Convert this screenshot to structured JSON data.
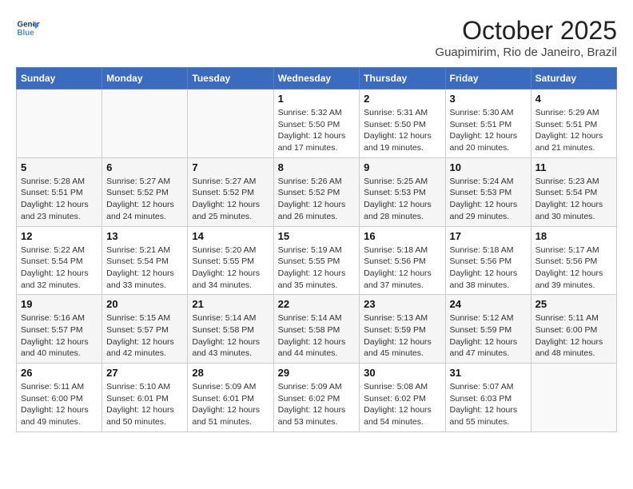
{
  "header": {
    "logo_line1": "General",
    "logo_line2": "Blue",
    "month": "October 2025",
    "location": "Guapimirim, Rio de Janeiro, Brazil"
  },
  "weekdays": [
    "Sunday",
    "Monday",
    "Tuesday",
    "Wednesday",
    "Thursday",
    "Friday",
    "Saturday"
  ],
  "weeks": [
    [
      {
        "day": "",
        "info": ""
      },
      {
        "day": "",
        "info": ""
      },
      {
        "day": "",
        "info": ""
      },
      {
        "day": "1",
        "info": "Sunrise: 5:32 AM\nSunset: 5:50 PM\nDaylight: 12 hours\nand 17 minutes."
      },
      {
        "day": "2",
        "info": "Sunrise: 5:31 AM\nSunset: 5:50 PM\nDaylight: 12 hours\nand 19 minutes."
      },
      {
        "day": "3",
        "info": "Sunrise: 5:30 AM\nSunset: 5:51 PM\nDaylight: 12 hours\nand 20 minutes."
      },
      {
        "day": "4",
        "info": "Sunrise: 5:29 AM\nSunset: 5:51 PM\nDaylight: 12 hours\nand 21 minutes."
      }
    ],
    [
      {
        "day": "5",
        "info": "Sunrise: 5:28 AM\nSunset: 5:51 PM\nDaylight: 12 hours\nand 23 minutes."
      },
      {
        "day": "6",
        "info": "Sunrise: 5:27 AM\nSunset: 5:52 PM\nDaylight: 12 hours\nand 24 minutes."
      },
      {
        "day": "7",
        "info": "Sunrise: 5:27 AM\nSunset: 5:52 PM\nDaylight: 12 hours\nand 25 minutes."
      },
      {
        "day": "8",
        "info": "Sunrise: 5:26 AM\nSunset: 5:52 PM\nDaylight: 12 hours\nand 26 minutes."
      },
      {
        "day": "9",
        "info": "Sunrise: 5:25 AM\nSunset: 5:53 PM\nDaylight: 12 hours\nand 28 minutes."
      },
      {
        "day": "10",
        "info": "Sunrise: 5:24 AM\nSunset: 5:53 PM\nDaylight: 12 hours\nand 29 minutes."
      },
      {
        "day": "11",
        "info": "Sunrise: 5:23 AM\nSunset: 5:54 PM\nDaylight: 12 hours\nand 30 minutes."
      }
    ],
    [
      {
        "day": "12",
        "info": "Sunrise: 5:22 AM\nSunset: 5:54 PM\nDaylight: 12 hours\nand 32 minutes."
      },
      {
        "day": "13",
        "info": "Sunrise: 5:21 AM\nSunset: 5:54 PM\nDaylight: 12 hours\nand 33 minutes."
      },
      {
        "day": "14",
        "info": "Sunrise: 5:20 AM\nSunset: 5:55 PM\nDaylight: 12 hours\nand 34 minutes."
      },
      {
        "day": "15",
        "info": "Sunrise: 5:19 AM\nSunset: 5:55 PM\nDaylight: 12 hours\nand 35 minutes."
      },
      {
        "day": "16",
        "info": "Sunrise: 5:18 AM\nSunset: 5:56 PM\nDaylight: 12 hours\nand 37 minutes."
      },
      {
        "day": "17",
        "info": "Sunrise: 5:18 AM\nSunset: 5:56 PM\nDaylight: 12 hours\nand 38 minutes."
      },
      {
        "day": "18",
        "info": "Sunrise: 5:17 AM\nSunset: 5:56 PM\nDaylight: 12 hours\nand 39 minutes."
      }
    ],
    [
      {
        "day": "19",
        "info": "Sunrise: 5:16 AM\nSunset: 5:57 PM\nDaylight: 12 hours\nand 40 minutes."
      },
      {
        "day": "20",
        "info": "Sunrise: 5:15 AM\nSunset: 5:57 PM\nDaylight: 12 hours\nand 42 minutes."
      },
      {
        "day": "21",
        "info": "Sunrise: 5:14 AM\nSunset: 5:58 PM\nDaylight: 12 hours\nand 43 minutes."
      },
      {
        "day": "22",
        "info": "Sunrise: 5:14 AM\nSunset: 5:58 PM\nDaylight: 12 hours\nand 44 minutes."
      },
      {
        "day": "23",
        "info": "Sunrise: 5:13 AM\nSunset: 5:59 PM\nDaylight: 12 hours\nand 45 minutes."
      },
      {
        "day": "24",
        "info": "Sunrise: 5:12 AM\nSunset: 5:59 PM\nDaylight: 12 hours\nand 47 minutes."
      },
      {
        "day": "25",
        "info": "Sunrise: 5:11 AM\nSunset: 6:00 PM\nDaylight: 12 hours\nand 48 minutes."
      }
    ],
    [
      {
        "day": "26",
        "info": "Sunrise: 5:11 AM\nSunset: 6:00 PM\nDaylight: 12 hours\nand 49 minutes."
      },
      {
        "day": "27",
        "info": "Sunrise: 5:10 AM\nSunset: 6:01 PM\nDaylight: 12 hours\nand 50 minutes."
      },
      {
        "day": "28",
        "info": "Sunrise: 5:09 AM\nSunset: 6:01 PM\nDaylight: 12 hours\nand 51 minutes."
      },
      {
        "day": "29",
        "info": "Sunrise: 5:09 AM\nSunset: 6:02 PM\nDaylight: 12 hours\nand 53 minutes."
      },
      {
        "day": "30",
        "info": "Sunrise: 5:08 AM\nSunset: 6:02 PM\nDaylight: 12 hours\nand 54 minutes."
      },
      {
        "day": "31",
        "info": "Sunrise: 5:07 AM\nSunset: 6:03 PM\nDaylight: 12 hours\nand 55 minutes."
      },
      {
        "day": "",
        "info": ""
      }
    ]
  ]
}
